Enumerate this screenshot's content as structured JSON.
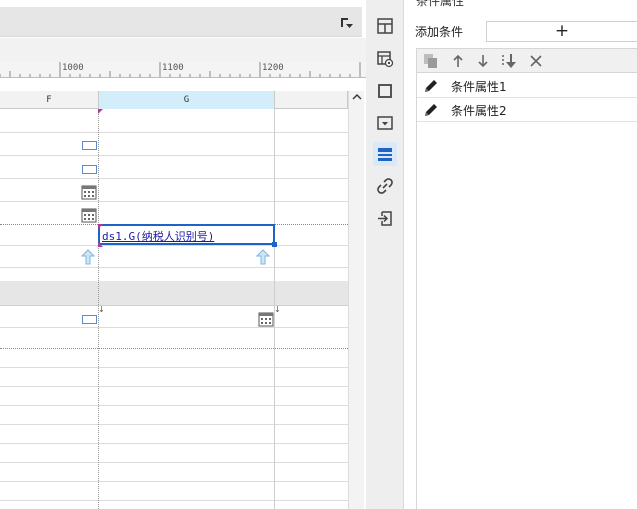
{
  "ruler": {
    "labels": [
      "1000",
      "1100",
      "1200"
    ]
  },
  "columns": {
    "f": "F",
    "g": "G"
  },
  "sheet": {
    "selected_cell_text": "ds1.G(纳税人识别号)"
  },
  "panel": {
    "title": "条件属性",
    "add_condition_label": "添加条件",
    "add_button": "+",
    "items": [
      {
        "label": "条件属性1"
      },
      {
        "label": "条件属性2"
      }
    ]
  },
  "icons": {
    "toolbar": "dropdown-menu-icon",
    "rail": [
      "cell-element-icon",
      "cell-attribute-icon",
      "border-icon",
      "widget-icon",
      "condition-attribute-icon",
      "hyperlink-icon",
      "import-icon"
    ],
    "cond_toolbar": [
      "copy-icon",
      "move-up-icon",
      "move-down-icon",
      "move-bottom-icon",
      "delete-icon"
    ]
  },
  "colors": {
    "accent": "#1e64c8",
    "selected_column": "#d3eefa"
  }
}
